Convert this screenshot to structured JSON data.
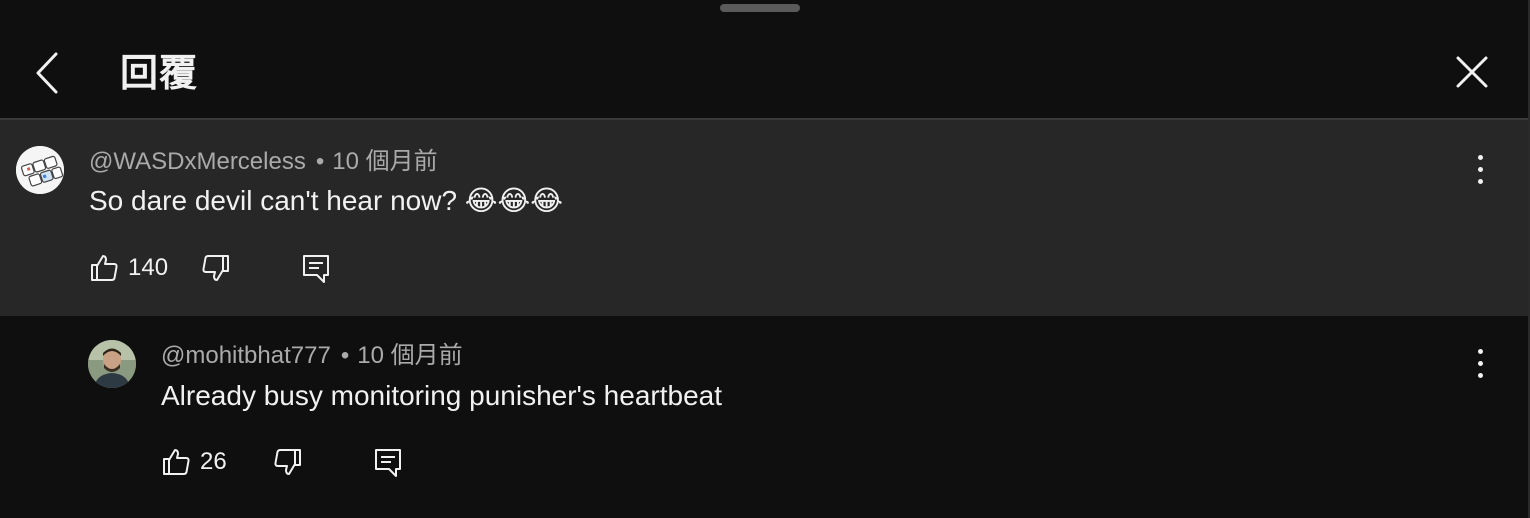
{
  "header": {
    "title": "回覆"
  },
  "comments": [
    {
      "author": "@WASDxMerceless",
      "separator": "•",
      "time": "10 個月前",
      "text": "So dare devil can't hear now? 😂😂😂",
      "likes": "140",
      "avatar_icon": "keyboard-keys-icon"
    },
    {
      "author": "@mohitbhat777",
      "separator": "•",
      "time": "10 個月前",
      "text": "Already busy monitoring punisher's heartbeat",
      "likes": "26",
      "avatar_icon": "profile-photo"
    }
  ],
  "colors": {
    "background": "#0f0f0f",
    "highlight_background": "#272727",
    "text_primary": "#f1f1f1",
    "text_secondary": "#aaaaaa"
  }
}
